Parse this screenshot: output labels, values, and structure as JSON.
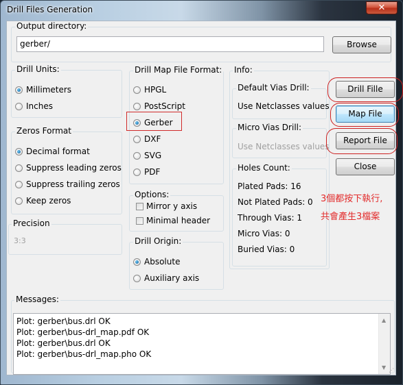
{
  "window": {
    "title": "Drill Files Generation",
    "close_glyph": "✕"
  },
  "output": {
    "group_label": "Output directory:",
    "value": "gerber/",
    "browse_label": "Browse"
  },
  "drill_units": {
    "label": "Drill Units:",
    "options": [
      {
        "label": "Millimeters",
        "selected": true
      },
      {
        "label": "Inches",
        "selected": false
      }
    ]
  },
  "zeros_format": {
    "label": "Zeros Format",
    "options": [
      {
        "label": "Decimal format",
        "selected": true
      },
      {
        "label": "Suppress leading zeros",
        "selected": false
      },
      {
        "label": "Suppress trailing zeros",
        "selected": false
      },
      {
        "label": "Keep zeros",
        "selected": false
      }
    ]
  },
  "precision": {
    "label": "Precision",
    "value": "3:3"
  },
  "map_format": {
    "label": "Drill Map File Format:",
    "options": [
      {
        "label": "HPGL",
        "selected": false
      },
      {
        "label": "PostScript",
        "selected": false
      },
      {
        "label": "Gerber",
        "selected": true
      },
      {
        "label": "DXF",
        "selected": false
      },
      {
        "label": "SVG",
        "selected": false
      },
      {
        "label": "PDF",
        "selected": false
      }
    ]
  },
  "options": {
    "label": "Options:",
    "items": [
      {
        "label": "Mirror y axis",
        "checked": false
      },
      {
        "label": "Minimal header",
        "checked": false
      }
    ]
  },
  "drill_origin": {
    "label": "Drill Origin:",
    "options": [
      {
        "label": "Absolute",
        "selected": true
      },
      {
        "label": "Auxiliary axis",
        "selected": false
      }
    ]
  },
  "info": {
    "label": "Info:",
    "default_vias": {
      "label": "Default Vias Drill:",
      "value": "Use Netclasses values"
    },
    "micro_vias": {
      "label": "Micro Vias Drill:",
      "value": "Use Netclasses values"
    },
    "holes": {
      "label": "Holes Count:",
      "lines": [
        "Plated Pads: 16",
        "Not Plated Pads: 0",
        "Through Vias: 1",
        "Micro Vias: 0",
        "Buried Vias: 0"
      ]
    }
  },
  "buttons": {
    "drill_file": "Drill Fille",
    "map_file": "Map File",
    "report_file": "Report File",
    "close": "Close"
  },
  "annotation": {
    "line1": "3個都按下執行,",
    "line2": "共會產生3檔案",
    "color": "#e22a2a"
  },
  "messages": {
    "label": "Messages:",
    "lines": [
      "Plot: gerber\\bus.drl OK",
      "Plot: gerber\\bus-drl_map.pdf OK",
      "Plot: gerber\\bus.drl OK",
      "Plot: gerber\\bus-drl_map.pho OK"
    ],
    "scroll_up": "▲",
    "scroll_down": "▼",
    "grip": "⋰"
  }
}
